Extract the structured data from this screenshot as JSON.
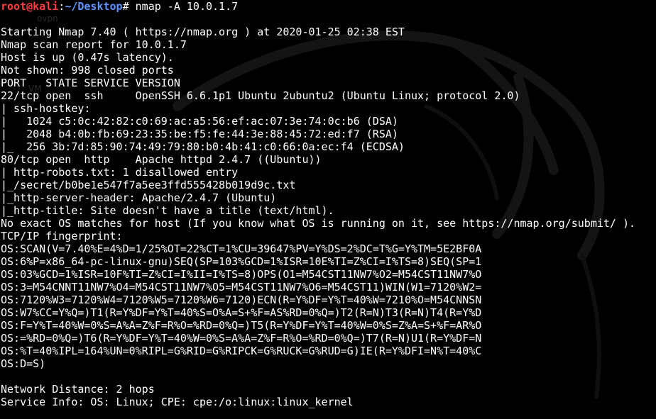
{
  "background_ghost": [
    "ovpn",
    "VM"
  ],
  "prompt": {
    "user_host": "root@kali",
    "sep": ":",
    "path": "~/Desktop",
    "symbol": "#",
    "command": " nmap -A 10.0.1.7"
  },
  "output": [
    "",
    "Starting Nmap 7.40 ( https://nmap.org ) at 2020-01-25 02:38 EST",
    "Nmap scan report for 10.0.1.7",
    "Host is up (0.47s latency).",
    "Not shown: 998 closed ports",
    "PORT   STATE SERVICE VERSION",
    "22/tcp open  ssh     OpenSSH 6.6.1p1 Ubuntu 2ubuntu2 (Ubuntu Linux; protocol 2.0)",
    "| ssh-hostkey: ",
    "|   1024 c5:0c:42:82:c0:69:ac:a5:56:ef:ac:07:3e:74:0c:b6 (DSA)",
    "|   2048 b4:0b:fb:69:23:35:be:f5:fe:44:3e:88:45:72:ed:f7 (RSA)",
    "|_  256 3b:7d:85:90:74:49:79:80:b0:4b:41:c0:66:0a:ec:f4 (ECDSA)",
    "80/tcp open  http    Apache httpd 2.4.7 ((Ubuntu))",
    "| http-robots.txt: 1 disallowed entry ",
    "|_/secret/b0be1e547f7a5ee3ffd555428b019d9c.txt",
    "|_http-server-header: Apache/2.4.7 (Ubuntu)",
    "|_http-title: Site doesn't have a title (text/html).",
    "No exact OS matches for host (If you know what OS is running on it, see https://nmap.org/submit/ ).",
    "TCP/IP fingerprint:",
    "OS:SCAN(V=7.40%E=4%D=1/25%OT=22%CT=1%CU=39647%PV=Y%DS=2%DC=T%G=Y%TM=5E2BF0A",
    "OS:6%P=x86_64-pc-linux-gnu)SEQ(SP=103%GCD=1%ISR=10E%TI=Z%CI=I%TS=8)SEQ(SP=1",
    "OS:03%GCD=1%ISR=10F%TI=Z%CI=I%II=I%TS=8)OPS(O1=M54CST11NW7%O2=M54CST11NW7%O",
    "OS:3=M54CNNT11NW7%O4=M54CST11NW7%O5=M54CST11NW7%O6=M54CST11)WIN(W1=7120%W2=",
    "OS:7120%W3=7120%W4=7120%W5=7120%W6=7120)ECN(R=Y%DF=Y%T=40%W=7210%O=M54CNNSN",
    "OS:W7%CC=Y%Q=)T1(R=Y%DF=Y%T=40%S=O%A=S+%F=AS%RD=0%Q=)T2(R=N)T3(R=N)T4(R=Y%D",
    "OS:F=Y%T=40%W=0%S=A%A=Z%F=R%O=%RD=0%Q=)T5(R=Y%DF=Y%T=40%W=0%S=Z%A=S+%F=AR%O",
    "OS:=%RD=0%Q=)T6(R=Y%DF=Y%T=40%W=0%S=A%A=Z%F=R%O=%RD=0%Q=)T7(R=N)U1(R=Y%DF=N",
    "OS:%T=40%IPL=164%UN=0%RIPL=G%RID=G%RIPCK=G%RUCK=G%RUD=G)IE(R=Y%DFI=N%T=40%C",
    "OS:D=S)",
    "",
    "Network Distance: 2 hops",
    "Service Info: OS: Linux; CPE: cpe:/o:linux:linux_kernel"
  ]
}
